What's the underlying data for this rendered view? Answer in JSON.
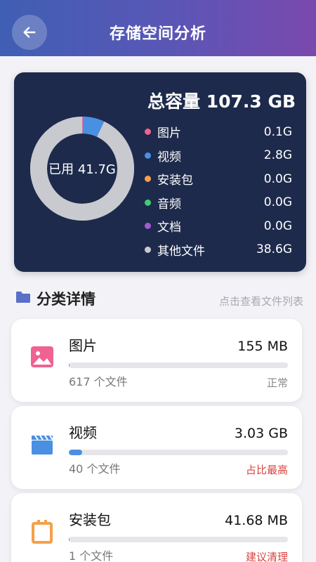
{
  "header": {
    "title": "存储空间分析",
    "back_icon": "arrow-left-icon"
  },
  "summary": {
    "total_label": "总容量 107.3 GB",
    "used_label": "已用 41.7G",
    "legend": [
      {
        "name": "图片",
        "value": "0.1G",
        "color": "#f06292"
      },
      {
        "name": "视频",
        "value": "2.8G",
        "color": "#4a90e2"
      },
      {
        "name": "安装包",
        "value": "0.0G",
        "color": "#f5a04a"
      },
      {
        "name": "音频",
        "value": "0.0G",
        "color": "#3ecf73"
      },
      {
        "name": "文档",
        "value": "0.0G",
        "color": "#a45bd0"
      },
      {
        "name": "其他文件",
        "value": "38.6G",
        "color": "#c8cacf"
      }
    ]
  },
  "section": {
    "title": "分类详情",
    "hint": "点击查看文件列表",
    "icon": "folder-icon"
  },
  "categories": [
    {
      "name": "图片",
      "size": "155 MB",
      "count": "617 个文件",
      "status": "正常",
      "status_color": "#8a8a8a",
      "fill_percent": 0.4,
      "icon": "image-icon",
      "icon_color": "#f06292"
    },
    {
      "name": "视频",
      "size": "3.03 GB",
      "count": "40 个文件",
      "status": "占比最高",
      "status_color": "#d64541",
      "fill_percent": 6,
      "icon": "video-clapper-icon",
      "icon_color": "#4a90e2"
    },
    {
      "name": "安装包",
      "size": "41.68 MB",
      "count": "1 个文件",
      "status": "建议清理",
      "status_color": "#d64541",
      "fill_percent": 0.1,
      "icon": "package-icon",
      "icon_color": "#f5a04a"
    }
  ]
}
